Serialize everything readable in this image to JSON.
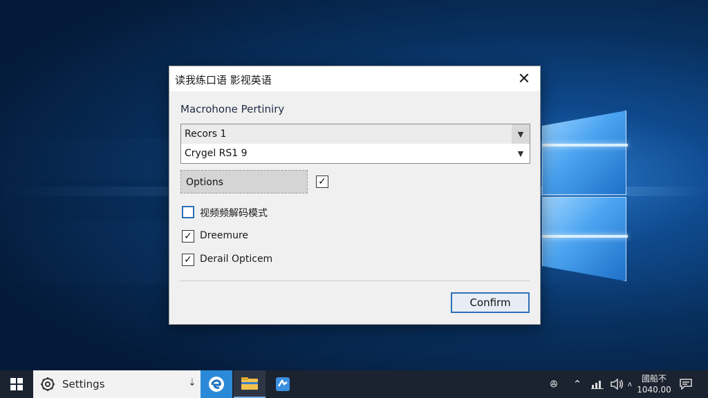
{
  "dialog": {
    "title": "读我练口语 影视英语",
    "close_glyph": "✕",
    "heading": "Macrohone Pertiniry",
    "dropdowns": [
      {
        "value": "Recors 1"
      },
      {
        "value": "Crygel RS1 9"
      }
    ],
    "dropdown_arrow": "▼",
    "options_button": "Options",
    "options_checkbox_checked": true,
    "checkboxes": [
      {
        "label": "视频频解码模式",
        "checked": false
      },
      {
        "label": "Dreemure",
        "checked": true
      },
      {
        "label": "Derail Opticem",
        "checked": true
      }
    ],
    "check_glyph": "✓",
    "confirm_label": "Confirm"
  },
  "taskbar": {
    "search_label": "Settings",
    "search_mic_glyph": "⇣",
    "apps": [
      {
        "name": "edge-icon",
        "active": false
      },
      {
        "name": "file-explorer-icon",
        "active": true
      },
      {
        "name": "app-icon",
        "active": false
      }
    ],
    "clock_line1": "國船不",
    "clock_line2": "1040.00"
  },
  "colors": {
    "accent": "#2f6fb7",
    "taskbar": "#1c2330"
  }
}
